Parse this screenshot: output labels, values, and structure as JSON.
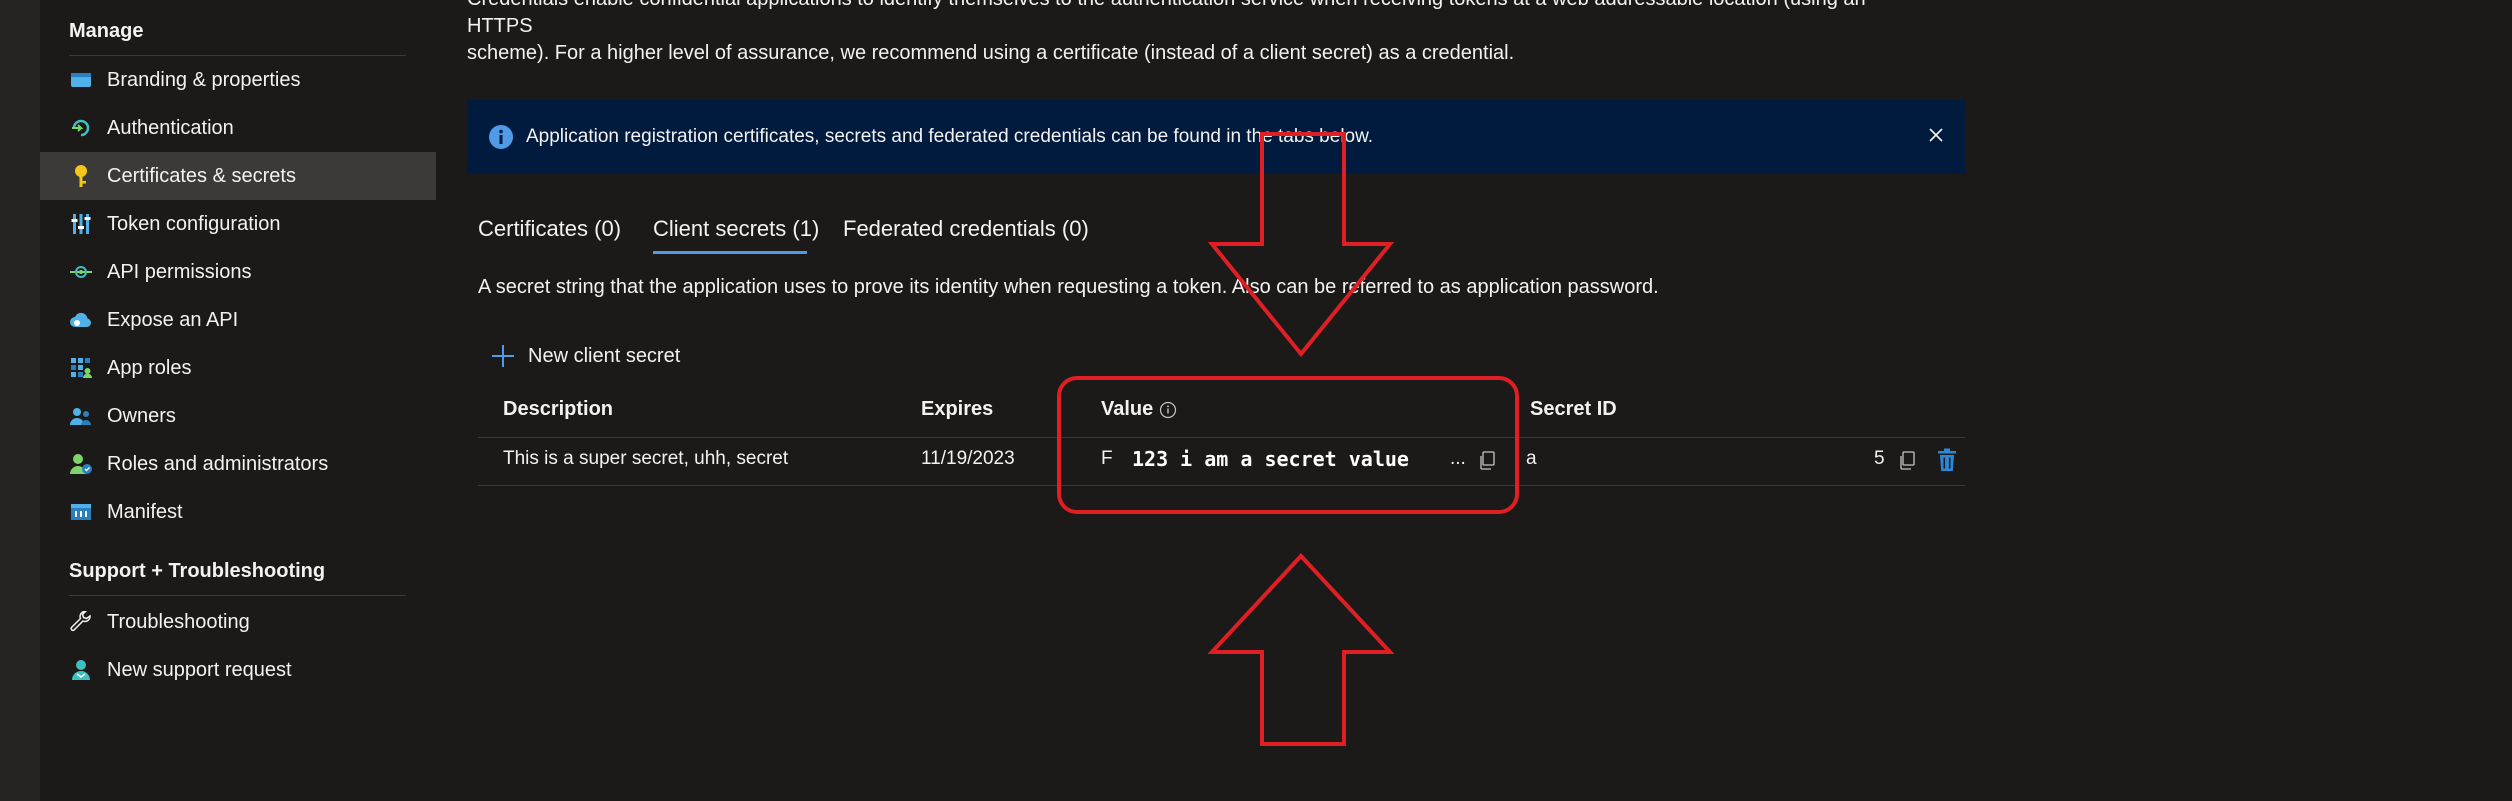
{
  "sidebar": {
    "manage_title": "Manage",
    "items": [
      {
        "label": "Branding & properties",
        "icon": "branding-icon"
      },
      {
        "label": "Authentication",
        "icon": "authentication-icon"
      },
      {
        "label": "Certificates & secrets",
        "icon": "key-icon",
        "active": true
      },
      {
        "label": "Token configuration",
        "icon": "token-config-icon"
      },
      {
        "label": "API permissions",
        "icon": "api-permissions-icon"
      },
      {
        "label": "Expose an API",
        "icon": "cloud-icon"
      },
      {
        "label": "App roles",
        "icon": "app-roles-icon"
      },
      {
        "label": "Owners",
        "icon": "owners-icon"
      },
      {
        "label": "Roles and administrators",
        "icon": "roles-admin-icon"
      },
      {
        "label": "Manifest",
        "icon": "manifest-icon"
      }
    ],
    "support_title": "Support + Troubleshooting",
    "support_items": [
      {
        "label": "Troubleshooting",
        "icon": "wrench-icon"
      },
      {
        "label": "New support request",
        "icon": "support-person-icon"
      }
    ]
  },
  "main": {
    "intro_line1": "Credentials enable confidential applications to identify themselves to the authentication service when receiving tokens at a web addressable location (using an HTTPS",
    "intro_line2": "scheme). For a higher level of assurance, we recommend using a certificate (instead of a client secret) as a credential.",
    "banner_text": "Application registration certificates, secrets and federated credentials can be found in the tabs below.",
    "tabs": [
      {
        "label": "Certificates (0)"
      },
      {
        "label": "Client secrets (1)",
        "active": true
      },
      {
        "label": "Federated credentials (0)"
      }
    ],
    "tab_description": "A secret string that the application uses to prove its identity when requesting a token. Also can be referred to as application password.",
    "new_secret_label": "New client secret",
    "table": {
      "headers": [
        "Description",
        "Expires",
        "Value",
        "Secret ID"
      ],
      "rows": [
        {
          "description": "This is a super secret, uhh, secret",
          "expires": "11/19/2023",
          "value_prefix": "F",
          "value": "123 i am a secret value",
          "value_ellipsis": "...",
          "secret_id_prefix": "a",
          "secret_id_suffix": "5"
        }
      ]
    }
  },
  "colors": {
    "accent": "#4f9be8",
    "banner_bg": "#001b3d",
    "annotation_red": "#e01f25",
    "delete_blue": "#2b88d8"
  }
}
